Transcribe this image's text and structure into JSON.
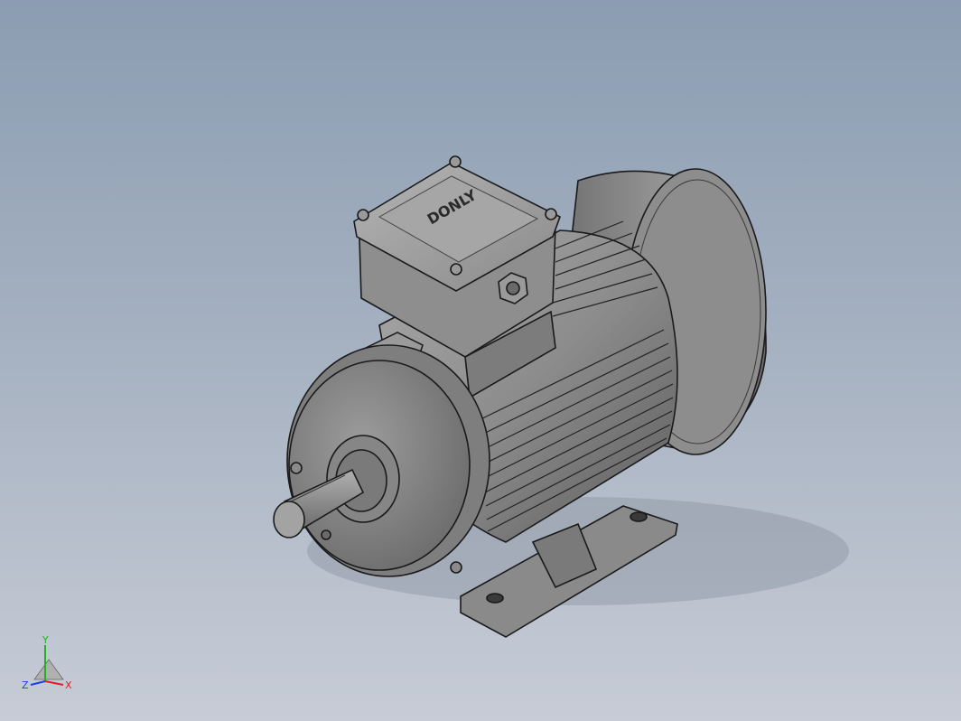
{
  "viewport": {
    "background_top": "#8b9db2",
    "background_bottom": "#c7ccd6"
  },
  "model": {
    "type": "three-phase electric motor",
    "terminal_box_logo": "DONLY",
    "body_color": "#8a8a8a",
    "edge_color": "#1a1a1a"
  },
  "triad": {
    "x_label": "X",
    "y_label": "Y",
    "z_label": "Z",
    "x_color": "#e02020",
    "y_color": "#20b020",
    "z_color": "#2040e0"
  }
}
